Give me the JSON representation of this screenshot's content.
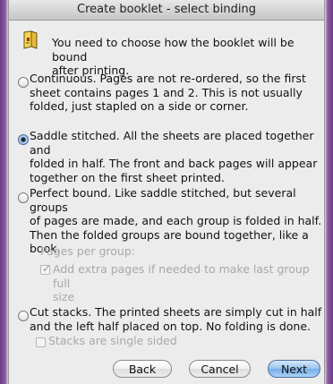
{
  "window": {
    "title": "Create booklet - select binding"
  },
  "intro": {
    "icon": "booklet-icon",
    "text": "You need to choose how the booklet will be bound\nafter printing."
  },
  "options": {
    "continuous": {
      "text": "Continuous. Pages are not re-ordered, so the first\nsheet contains pages 1 and 2. This is not usually\nfolded, just stapled on a side or corner.",
      "selected": false
    },
    "saddle": {
      "text": "Saddle stitched. All the sheets are placed together and\nfolded in half. The front and back pages will appear\ntogether on the first sheet printed.",
      "selected": true
    },
    "perfect": {
      "text": "Perfect bound. Like saddle stitched, but several groups\nof pages are made, and each group is folded in half.\nThen the folded groups are bound together, like a\nbook.",
      "selected": false,
      "pages_per_group_label": "Pages per group:",
      "extra_pages_label": "Add extra pages if needed to make last group full\nsize",
      "extra_pages_checked": true
    },
    "cut": {
      "text": "Cut stacks. The printed sheets are simply cut in half\nand the left half placed on top. No folding is done.",
      "selected": false,
      "single_sided_label": "Stacks are single sided",
      "single_sided_checked": false
    }
  },
  "buttons": {
    "back": "Back",
    "cancel": "Cancel",
    "next": "Next"
  }
}
